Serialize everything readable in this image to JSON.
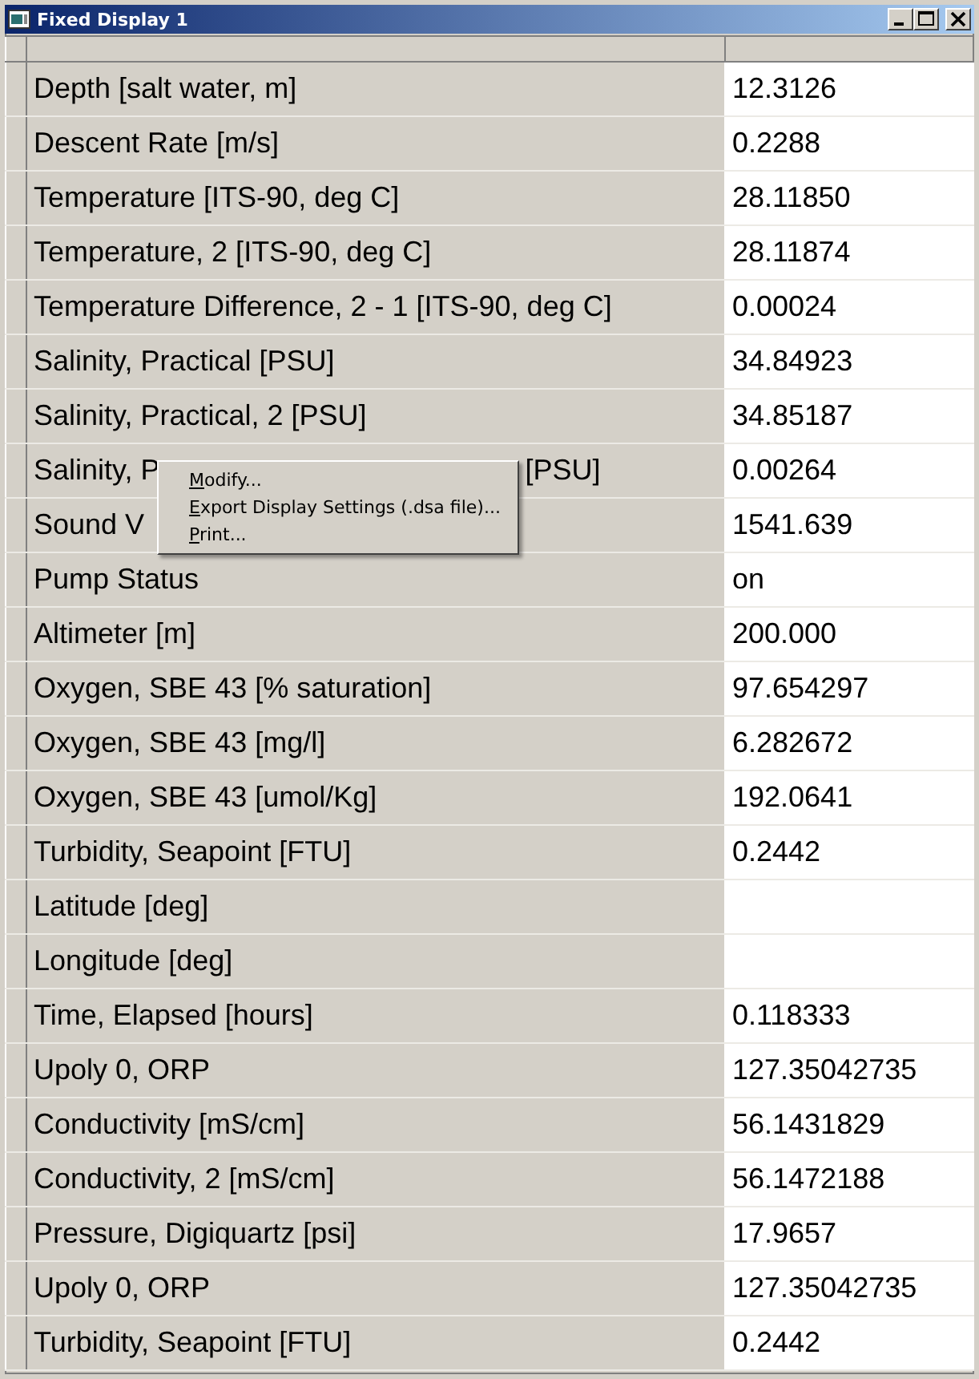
{
  "window": {
    "title": "Fixed Display 1"
  },
  "rows": [
    {
      "label": "Depth [salt water, m]",
      "value": "12.3126"
    },
    {
      "label": "Descent Rate [m/s]",
      "value": "0.2288"
    },
    {
      "label": "Temperature [ITS-90, deg C]",
      "value": "28.11850"
    },
    {
      "label": "Temperature, 2 [ITS-90, deg C]",
      "value": "28.11874"
    },
    {
      "label": "Temperature Difference, 2 - 1 [ITS-90, deg C]",
      "value": "0.00024"
    },
    {
      "label": "Salinity, Practical [PSU]",
      "value": "34.84923"
    },
    {
      "label": "Salinity, Practical, 2 [PSU]",
      "value": "34.85187"
    },
    {
      "label": "Salinity, P",
      "label_tail": "[PSU]",
      "value": "0.00264"
    },
    {
      "label": "Sound V",
      "value": "1541.639"
    },
    {
      "label": "Pump Status",
      "value": "on"
    },
    {
      "label": "Altimeter [m]",
      "value": "200.000"
    },
    {
      "label": "Oxygen, SBE 43 [% saturation]",
      "value": "97.654297"
    },
    {
      "label": "Oxygen, SBE 43 [mg/l]",
      "value": "6.282672"
    },
    {
      "label": "Oxygen, SBE 43 [umol/Kg]",
      "value": "192.0641"
    },
    {
      "label": "Turbidity, Seapoint [FTU]",
      "value": "0.2442"
    },
    {
      "label": "Latitude [deg]"
    },
    {
      "label": "Longitude [deg]"
    },
    {
      "label": "Time, Elapsed [hours]",
      "value": "0.118333"
    },
    {
      "label": "Upoly 0, ORP",
      "value": "127.35042735"
    },
    {
      "label": "Conductivity [mS/cm]",
      "value": "56.1431829"
    },
    {
      "label": "Conductivity, 2 [mS/cm]",
      "value": "56.1472188"
    },
    {
      "label": "Pressure, Digiquartz [psi]",
      "value": "17.9657"
    },
    {
      "label": "Upoly 0, ORP",
      "value": "127.35042735"
    },
    {
      "label": "Turbidity, Seapoint [FTU]",
      "value": "0.2442"
    }
  ],
  "context_menu": {
    "items": [
      "Modify...",
      "Export Display Settings (.dsa file)...",
      "Print..."
    ]
  }
}
